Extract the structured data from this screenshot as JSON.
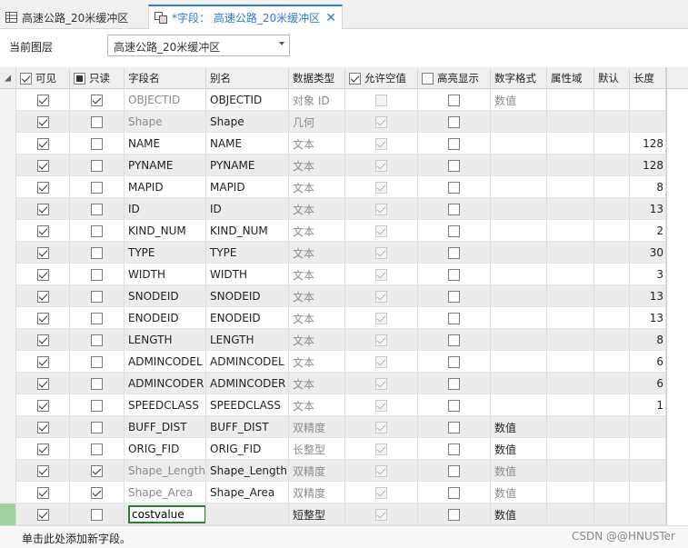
{
  "tabs": [
    {
      "label": "高速公路_20米缓冲区",
      "active": false,
      "icon": "table-icon"
    },
    {
      "label": "*字段：  高速公路_20米缓冲区",
      "active": true,
      "icon": "fields-icon"
    }
  ],
  "layer": {
    "label": "当前图层",
    "value": "高速公路_20米缓冲区"
  },
  "columns": [
    "可见",
    "只读",
    "字段名",
    "别名",
    "数据类型",
    "允许空值",
    "高亮显示",
    "数字格式",
    "属性域",
    "默认",
    "长度"
  ],
  "rows": [
    {
      "visible": true,
      "readonly": true,
      "name": "OBJECTID",
      "alias": "OBJECTID",
      "type": "对象 ID",
      "nullable": false,
      "highlight": false,
      "numfmt": "数值",
      "length": "",
      "grey": true
    },
    {
      "visible": true,
      "readonly": false,
      "name": "Shape",
      "alias": "Shape",
      "type": "几何",
      "nullable": true,
      "highlight": false,
      "numfmt": "",
      "length": "",
      "grey": true
    },
    {
      "visible": true,
      "readonly": false,
      "name": "NAME",
      "alias": "NAME",
      "type": "文本",
      "nullable": true,
      "highlight": false,
      "numfmt": "",
      "length": "128",
      "grey": false
    },
    {
      "visible": true,
      "readonly": false,
      "name": "PYNAME",
      "alias": "PYNAME",
      "type": "文本",
      "nullable": true,
      "highlight": false,
      "numfmt": "",
      "length": "128",
      "grey": false
    },
    {
      "visible": true,
      "readonly": false,
      "name": "MAPID",
      "alias": "MAPID",
      "type": "文本",
      "nullable": true,
      "highlight": false,
      "numfmt": "",
      "length": "8",
      "grey": false
    },
    {
      "visible": true,
      "readonly": false,
      "name": "ID",
      "alias": "ID",
      "type": "文本",
      "nullable": true,
      "highlight": false,
      "numfmt": "",
      "length": "13",
      "grey": false
    },
    {
      "visible": true,
      "readonly": false,
      "name": "KIND_NUM",
      "alias": "KIND_NUM",
      "type": "文本",
      "nullable": true,
      "highlight": false,
      "numfmt": "",
      "length": "2",
      "grey": false
    },
    {
      "visible": true,
      "readonly": false,
      "name": "TYPE",
      "alias": "TYPE",
      "type": "文本",
      "nullable": true,
      "highlight": false,
      "numfmt": "",
      "length": "30",
      "grey": false
    },
    {
      "visible": true,
      "readonly": false,
      "name": "WIDTH",
      "alias": "WIDTH",
      "type": "文本",
      "nullable": true,
      "highlight": false,
      "numfmt": "",
      "length": "3",
      "grey": false
    },
    {
      "visible": true,
      "readonly": false,
      "name": "SNODEID",
      "alias": "SNODEID",
      "type": "文本",
      "nullable": true,
      "highlight": false,
      "numfmt": "",
      "length": "13",
      "grey": false
    },
    {
      "visible": true,
      "readonly": false,
      "name": "ENODEID",
      "alias": "ENODEID",
      "type": "文本",
      "nullable": true,
      "highlight": false,
      "numfmt": "",
      "length": "13",
      "grey": false
    },
    {
      "visible": true,
      "readonly": false,
      "name": "LENGTH",
      "alias": "LENGTH",
      "type": "文本",
      "nullable": true,
      "highlight": false,
      "numfmt": "",
      "length": "8",
      "grey": false
    },
    {
      "visible": true,
      "readonly": false,
      "name": "ADMINCODEL",
      "alias": "ADMINCODEL",
      "type": "文本",
      "nullable": true,
      "highlight": false,
      "numfmt": "",
      "length": "6",
      "grey": false
    },
    {
      "visible": true,
      "readonly": false,
      "name": "ADMINCODER",
      "alias": "ADMINCODER",
      "type": "文本",
      "nullable": true,
      "highlight": false,
      "numfmt": "",
      "length": "6",
      "grey": false
    },
    {
      "visible": true,
      "readonly": false,
      "name": "SPEEDCLASS",
      "alias": "SPEEDCLASS",
      "type": "文本",
      "nullable": true,
      "highlight": false,
      "numfmt": "",
      "length": "1",
      "grey": false
    },
    {
      "visible": true,
      "readonly": false,
      "name": "BUFF_DIST",
      "alias": "BUFF_DIST",
      "type": "双精度",
      "nullable": true,
      "highlight": false,
      "numfmt": "数值",
      "length": "",
      "grey": false
    },
    {
      "visible": true,
      "readonly": false,
      "name": "ORIG_FID",
      "alias": "ORIG_FID",
      "type": "长整型",
      "nullable": true,
      "highlight": false,
      "numfmt": "数值",
      "length": "",
      "grey": false
    },
    {
      "visible": true,
      "readonly": true,
      "name": "Shape_Length",
      "alias": "Shape_Length",
      "type": "双精度",
      "nullable": true,
      "highlight": false,
      "numfmt": "数值",
      "length": "",
      "grey": true
    },
    {
      "visible": true,
      "readonly": true,
      "name": "Shape_Area",
      "alias": "Shape_Area",
      "type": "双精度",
      "nullable": true,
      "highlight": false,
      "numfmt": "数值",
      "length": "",
      "grey": true
    }
  ],
  "new_row": {
    "visible": true,
    "readonly": false,
    "name": "costvalue",
    "alias": "",
    "type": "短整型",
    "nullable": true,
    "highlight": false,
    "numfmt": "数值",
    "length": ""
  },
  "footer": {
    "add_field": "单击此处添加新字段。",
    "watermark": "CSDN @@HNUSTer"
  }
}
